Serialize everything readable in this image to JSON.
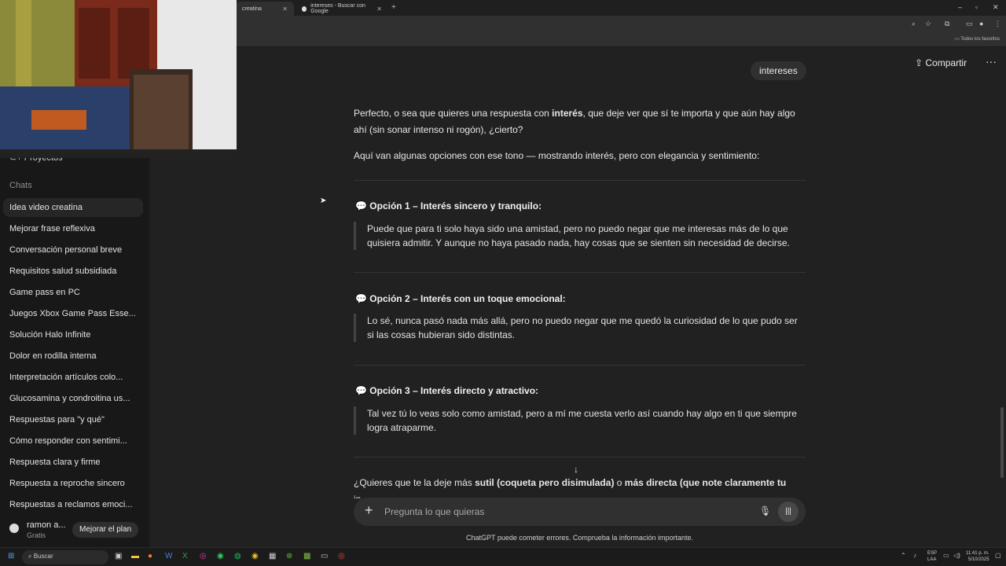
{
  "browser": {
    "tabs": [
      {
        "label": "creatina"
      },
      {
        "label": "intereses - Buscar con Google"
      }
    ],
    "new_tab": "+",
    "bookmarks_label": "Todos los favoritos",
    "window_controls": [
      "–",
      "▫",
      "✕"
    ]
  },
  "sidebar": {
    "projects_label": "Proyectos",
    "chats_heading": "Chats",
    "items": [
      {
        "label": "Idea video creatina"
      },
      {
        "label": "Mejorar frase reflexiva"
      },
      {
        "label": "Conversación personal breve"
      },
      {
        "label": "Requisitos salud subsidiada"
      },
      {
        "label": "Game pass en PC"
      },
      {
        "label": "Juegos Xbox Game Pass Esse..."
      },
      {
        "label": "Solución Halo Infinite"
      },
      {
        "label": "Dolor en rodilla interna"
      },
      {
        "label": "Interpretación artículos colo..."
      },
      {
        "label": "Glucosamina y condroitina us..."
      },
      {
        "label": "Respuestas para \"y qué\""
      },
      {
        "label": "Cómo responder con sentimi..."
      },
      {
        "label": "Respuesta clara y firme"
      },
      {
        "label": "Respuesta a reproche sincero"
      },
      {
        "label": "Respuestas a reclamos emoci..."
      }
    ],
    "user": {
      "name": "ramon a...",
      "plan": "Gratis",
      "upgrade_label": "Mejorar el plan"
    }
  },
  "header": {
    "share_label": "Compartir",
    "more_label": "···"
  },
  "conversation": {
    "user_message": "intereses",
    "intro_p1_a": "Perfecto, o sea que quieres una respuesta con ",
    "intro_p1_bold": "interés",
    "intro_p1_b": ", que deje ver que sí te importa y que aún hay algo ahí (sin sonar intenso ni rogón), ¿cierto?",
    "intro_p2": "Aquí van algunas opciones con ese tono — mostrando interés, pero con elegancia y sentimiento:",
    "options": [
      {
        "icon": "💬",
        "title": "Opción 1 – Interés sincero y tranquilo:",
        "text": "Puede que para ti solo haya sido una amistad, pero no puedo negar que me interesas más de lo que quisiera admitir. Y aunque no haya pasado nada, hay cosas que se sienten sin necesidad de decirse."
      },
      {
        "icon": "💬",
        "title": "Opción 2 – Interés con un toque emocional:",
        "text": "Lo sé, nunca pasó nada más allá, pero no puedo negar que me quedó la curiosidad de lo que pudo ser si las cosas hubieran sido distintas."
      },
      {
        "icon": "💬",
        "title": "Opción 3 – Interés directo y atractivo:",
        "text": "Tal vez tú lo veas solo como amistad, pero a mí me cuesta verlo así cuando hay algo en ti que siempre logra atraparme."
      }
    ],
    "closing_a": "¿Quieres que te la deje más ",
    "closing_b": "sutil (coqueta pero disimulada)",
    "closing_c": " o ",
    "closing_d": "más directa (que note claramente tu",
    "closing_e": "in"
  },
  "composer": {
    "placeholder": "Pregunta lo que quieras",
    "plus": "+",
    "disclaimer": "ChatGPT puede cometer errores. Comprueba la información importante."
  },
  "taskbar": {
    "search_label": "Buscar",
    "lang_top": "ESP",
    "lang_bottom": "LAA",
    "time": "11:41 p. m.",
    "date": "5/10/2025"
  }
}
